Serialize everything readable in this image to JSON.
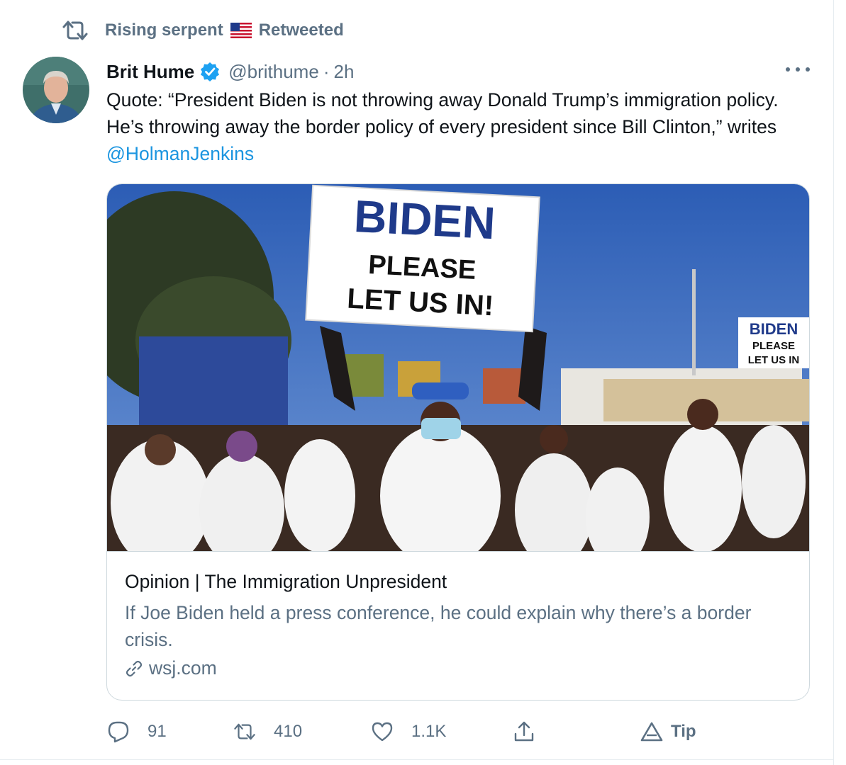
{
  "social_context": {
    "retweeter": "Rising serpent",
    "label": "Retweeted"
  },
  "tweet": {
    "author_name": "Brit Hume",
    "handle": "@brithume",
    "separator": "·",
    "time": "2h",
    "text_main": "Quote: “President Biden is not throwing away Donald Trump’s immigration policy. He’s throwing away the border policy of every president since Bill Clinton,” writes ",
    "mention": "@HolmanJenkins"
  },
  "card": {
    "image_sign_main": {
      "line1": "BIDEN",
      "line2": "PLEASE",
      "line3": "LET US IN!"
    },
    "image_sign_small": {
      "line1": "BIDEN",
      "line2": "PLEASE",
      "line3": "LET US IN"
    },
    "title": "Opinion | The Immigration Unpresident",
    "description": "If Joe Biden held a press conference, he could explain why there’s a border crisis.",
    "domain": "wsj.com"
  },
  "actions": {
    "reply_count": "91",
    "retweet_count": "410",
    "like_count": "1.1K",
    "tip_label": "Tip"
  },
  "colors": {
    "link": "#1b95e0",
    "secondary_text": "#5b7083",
    "verified": "#1da1f2",
    "border": "#cfd9de"
  }
}
